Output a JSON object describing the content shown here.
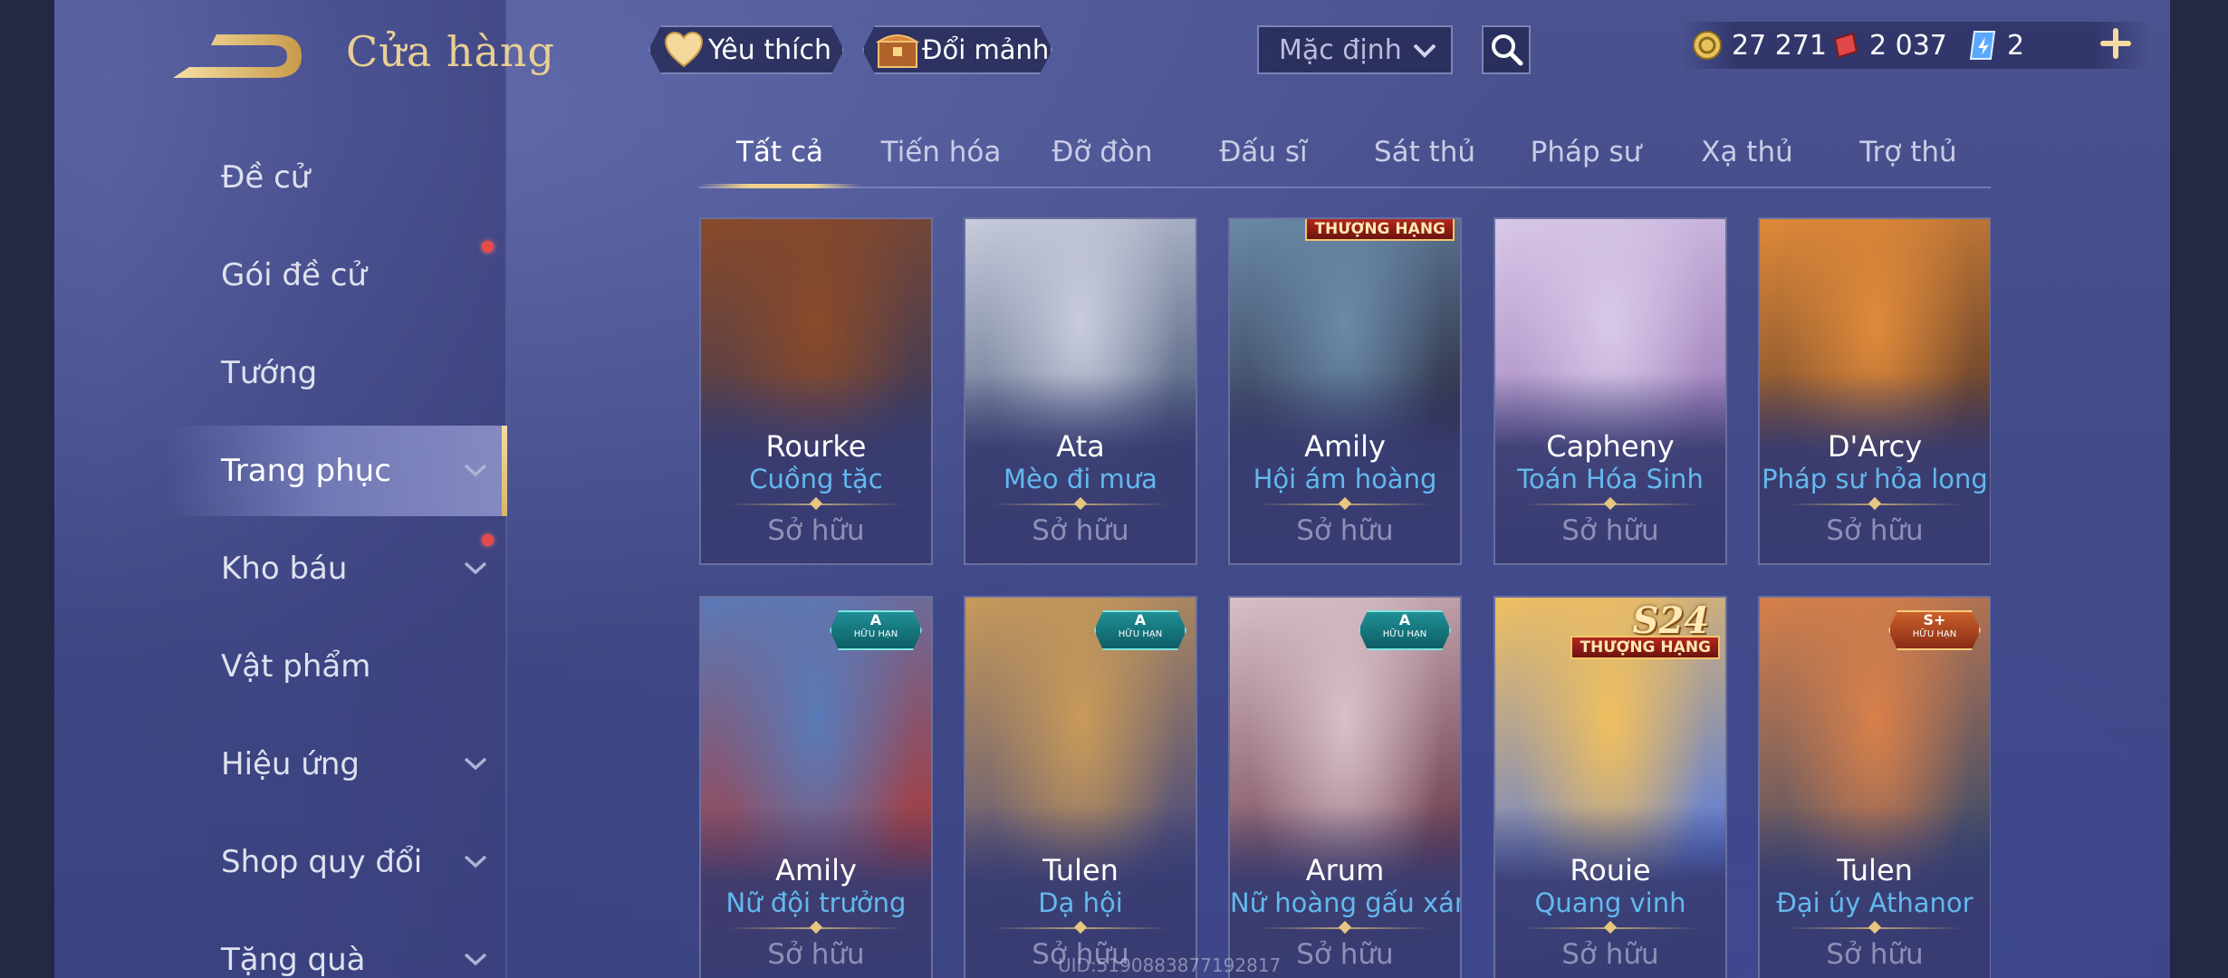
{
  "header": {
    "title": "Cửa hàng",
    "favorites_label": "Yêu thích",
    "exchange_label": "Đổi mảnh",
    "sort": {
      "selected": "Mặc định"
    }
  },
  "currencies": [
    {
      "name": "gold-coin",
      "value": "27 271",
      "color": "#e8c25a"
    },
    {
      "name": "red-voucher",
      "value": "2 037",
      "color": "#e0464a"
    },
    {
      "name": "blue-card",
      "value": "2",
      "color": "#5aa8ff"
    }
  ],
  "sidebar": {
    "items": [
      {
        "label": "Đề cử",
        "has_chevron": false,
        "notify": false,
        "active": false
      },
      {
        "label": "Gói đề cử",
        "has_chevron": false,
        "notify": true,
        "active": false
      },
      {
        "label": "Tướng",
        "has_chevron": false,
        "notify": false,
        "active": false
      },
      {
        "label": "Trang phục",
        "has_chevron": true,
        "notify": false,
        "active": true
      },
      {
        "label": "Kho báu",
        "has_chevron": true,
        "notify": true,
        "active": false
      },
      {
        "label": "Vật phẩm",
        "has_chevron": false,
        "notify": false,
        "active": false
      },
      {
        "label": "Hiệu ứng",
        "has_chevron": true,
        "notify": false,
        "active": false
      },
      {
        "label": "Shop quy đổi",
        "has_chevron": true,
        "notify": false,
        "active": false
      },
      {
        "label": "Tặng quà",
        "has_chevron": true,
        "notify": false,
        "active": false
      }
    ]
  },
  "tabs": [
    {
      "label": "Tất cả",
      "active": true
    },
    {
      "label": "Tiến hóa",
      "active": false
    },
    {
      "label": "Đỡ đòn",
      "active": false
    },
    {
      "label": "Đấu sĩ",
      "active": false
    },
    {
      "label": "Sát thủ",
      "active": false
    },
    {
      "label": "Pháp sư",
      "active": false
    },
    {
      "label": "Xạ thủ",
      "active": false
    },
    {
      "label": "Trợ thủ",
      "active": false
    }
  ],
  "cards": [
    {
      "hero": "Rourke",
      "skin": "Cuồng tặc",
      "status": "Sở hữu",
      "palette": [
        "#8a4a2a",
        "#3a3a5a"
      ]
    },
    {
      "hero": "Ata",
      "skin": "Mèo đi mưa",
      "status": "Sở hữu",
      "palette": [
        "#c8ccdc",
        "#4a5a7a"
      ]
    },
    {
      "hero": "Amily",
      "skin": "Hội ám hoàng",
      "status": "Sở hữu",
      "palette": [
        "#6a8aa8",
        "#2a2a40"
      ],
      "rank_badge": "THƯỢNG HẠNG"
    },
    {
      "hero": "Capheny",
      "skin": "Toán Hóa Sinh",
      "status": "Sở hữu",
      "palette": [
        "#d8c8e8",
        "#9a7ab8"
      ]
    },
    {
      "hero": "D'Arcy",
      "skin": "Pháp sư hỏa long",
      "status": "Sở hữu",
      "palette": [
        "#e08a3a",
        "#5a3a2a"
      ]
    },
    {
      "hero": "Amily",
      "skin": "Nữ đội trưởng",
      "status": "Sở hữu",
      "palette": [
        "#5a7ab8",
        "#a83a3a"
      ],
      "badge": {
        "grade": "A",
        "sub": "HỮU HẠN"
      }
    },
    {
      "hero": "Tulen",
      "skin": "Dạ hội",
      "status": "Sở hữu",
      "palette": [
        "#c89a5a",
        "#4a4a7a"
      ],
      "badge": {
        "grade": "A",
        "sub": "HỮU HẠN"
      }
    },
    {
      "hero": "Arum",
      "skin": "Nữ hoàng gấu xám",
      "status": "Sở hữu",
      "palette": [
        "#d8c0c8",
        "#6a3a4a"
      ],
      "badge": {
        "grade": "A",
        "sub": "HỮU HẠN"
      }
    },
    {
      "hero": "Rouie",
      "skin": "Quang vinh",
      "status": "Sở hữu",
      "palette": [
        "#f0c060",
        "#5a7ad8"
      ],
      "rank_badge": "THƯỢNG HẠNG",
      "season_badge": "S24"
    },
    {
      "hero": "Tulen",
      "skin": "Đại úy Athanor",
      "status": "Sở hữu",
      "palette": [
        "#d8804a",
        "#3a4a6a"
      ],
      "badge": {
        "grade": "S+",
        "sub": "HỮU HẠN",
        "gold": true
      }
    }
  ],
  "footer": {
    "uid": "UID:5190883877192817"
  }
}
